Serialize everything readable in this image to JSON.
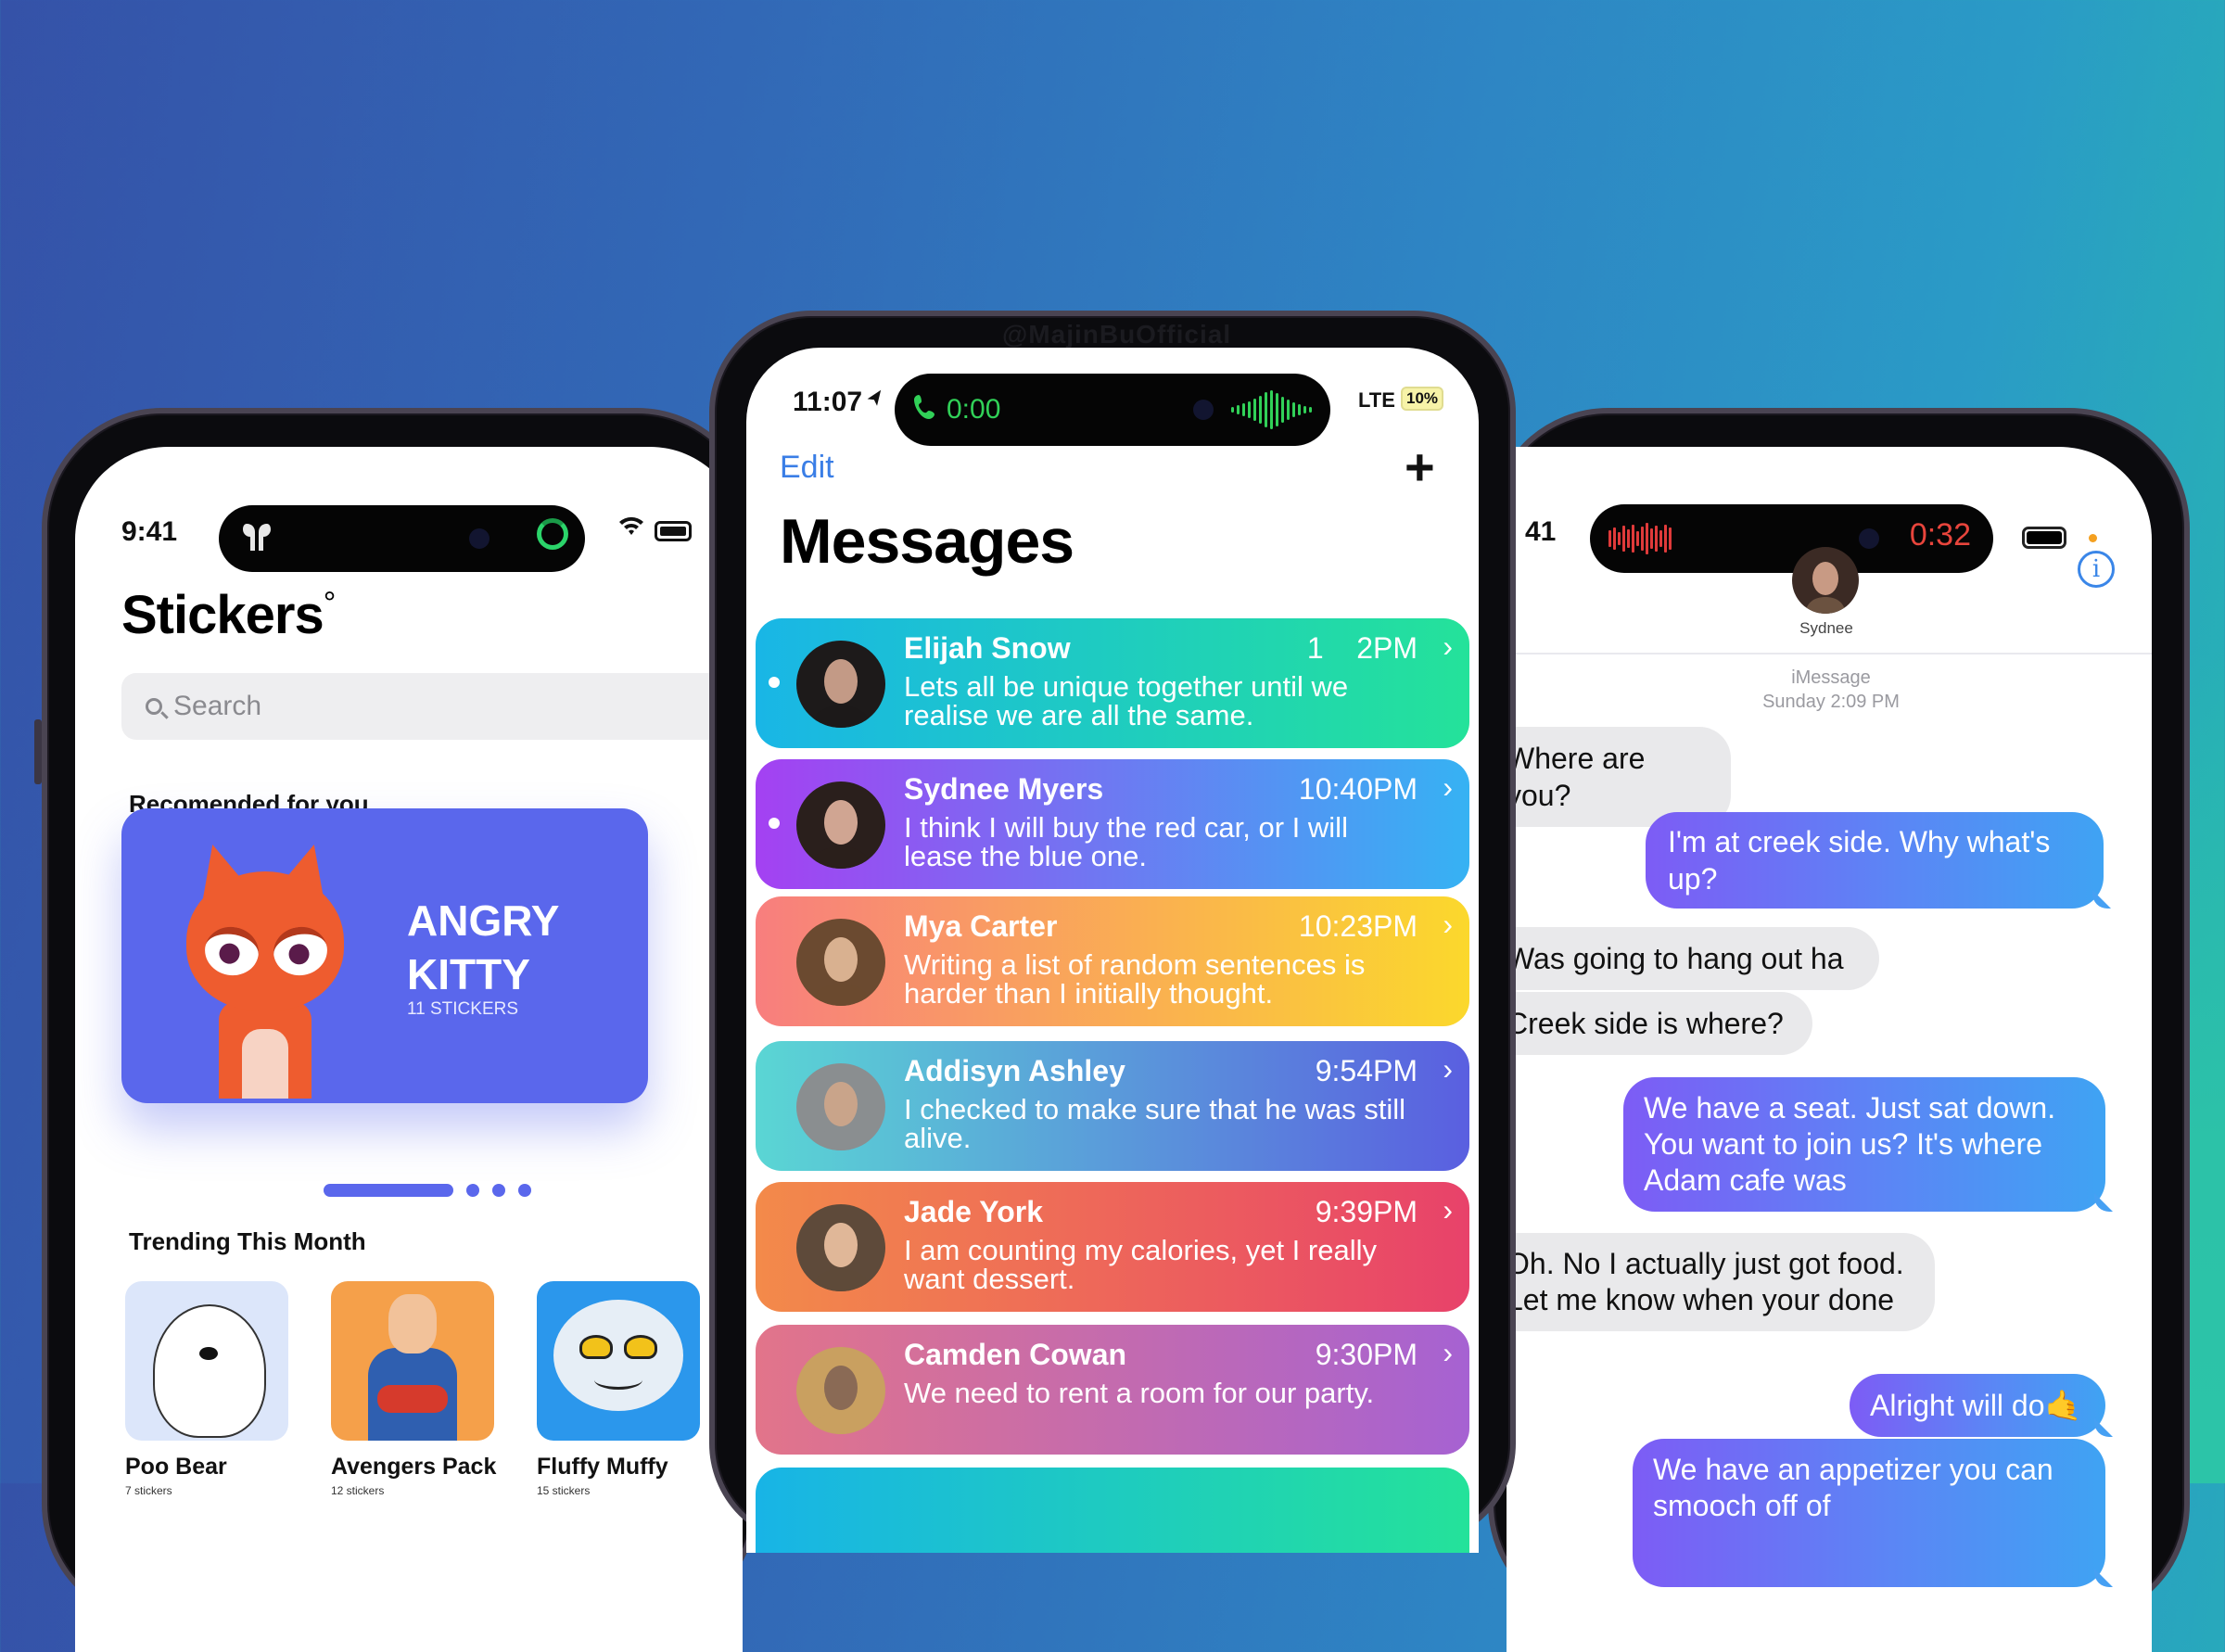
{
  "watermark": "@MajinBuOfficial",
  "stickers_phone": {
    "status": {
      "time": "9:41",
      "airpods_glyph": "𝛘",
      "dynamic_island_activity": "airpods-ring"
    },
    "title": "Stickers",
    "title_mark": "°",
    "search": {
      "placeholder": "Search"
    },
    "recommended": {
      "heading": "Recomended for you",
      "featured": {
        "title_line1": "ANGRY",
        "title_line2": "KITTY",
        "count": "11 STICKERS",
        "color": "#5a67ec"
      },
      "carousel": {
        "pages": 4,
        "active": 1
      }
    },
    "trending": {
      "heading": "Trending This Month",
      "items": [
        {
          "name": "Poo Bear",
          "count": "7 stickers",
          "bg": "#dce6fa"
        },
        {
          "name": "Avengers Pack",
          "count": "12 stickers",
          "bg": "#f5a04a"
        },
        {
          "name": "Fluffy Muffy",
          "count": "15 stickers",
          "bg": "#2b97ec"
        }
      ]
    }
  },
  "messages_phone": {
    "status": {
      "time": "11:07",
      "location_glyph": "➤",
      "call_icon": "📞",
      "call_timer": "0:00",
      "network": "LTE",
      "battery": "10%"
    },
    "nav": {
      "edit": "Edit",
      "compose": "+"
    },
    "title": "Messages",
    "conversations": [
      {
        "name": "Elijah Snow",
        "time": "1    2PM",
        "preview": "Lets all be unique together until we realise we are all the same.",
        "unread": true,
        "gradient": [
          "#19b6e6",
          "#24e29a"
        ]
      },
      {
        "name": "Sydnee Myers",
        "time": "10:40PM",
        "preview": "I think I will buy the red car, or I will lease the blue one.",
        "unread": true,
        "gradient": [
          "#a441f2",
          "#36b2f3"
        ]
      },
      {
        "name": "Mya Carter",
        "time": "10:23PM",
        "preview": "Writing a list of random sentences is harder than I initially thought.",
        "unread": false,
        "gradient": [
          "#f87e7e",
          "#fbd82c"
        ]
      },
      {
        "name": "Addisyn Ashley",
        "time": "9:54PM",
        "preview": "I checked to make sure that he was still alive.",
        "unread": false,
        "gradient": [
          "#5ad6d4",
          "#5a5fe0"
        ]
      },
      {
        "name": "Jade York",
        "time": "9:39PM",
        "preview": "I am counting my calories, yet I really want dessert.",
        "unread": false,
        "gradient": [
          "#f38a4a",
          "#e8426a"
        ]
      },
      {
        "name": "Camden Cowan",
        "time": "9:30PM",
        "preview": "We need to rent a room for our party.",
        "unread": false,
        "gradient": [
          "#e2748a",
          "#a662d2"
        ]
      },
      {
        "name": "",
        "time": "",
        "preview": "",
        "unread": false,
        "gradient": [
          "#18b4e6",
          "#24e29a"
        ]
      }
    ],
    "chevron": "›"
  },
  "chat_phone": {
    "status": {
      "time_partial": "41",
      "record_timer": "0:32"
    },
    "contact": {
      "name": "Sydnee"
    },
    "info_icon": "i",
    "thread_meta": {
      "service": "iMessage",
      "date": "Sunday 2:09 PM"
    },
    "messages": [
      {
        "dir": "in",
        "text": "Where are you?"
      },
      {
        "dir": "out",
        "text": "I'm at creek side. Why what's up?"
      },
      {
        "dir": "in",
        "text": "Was going to hang out ha"
      },
      {
        "dir": "in",
        "text": "Creek side is where?"
      },
      {
        "dir": "out",
        "text": "We have a seat. Just sat down. You want to join us? It's where Adam cafe was"
      },
      {
        "dir": "in",
        "text": "Oh. No I actually just got food. Let me know when your done"
      },
      {
        "dir": "out",
        "text": "Alright will do🤙"
      },
      {
        "dir": "out",
        "text": "We have an appetizer you can smooch off of"
      }
    ]
  }
}
